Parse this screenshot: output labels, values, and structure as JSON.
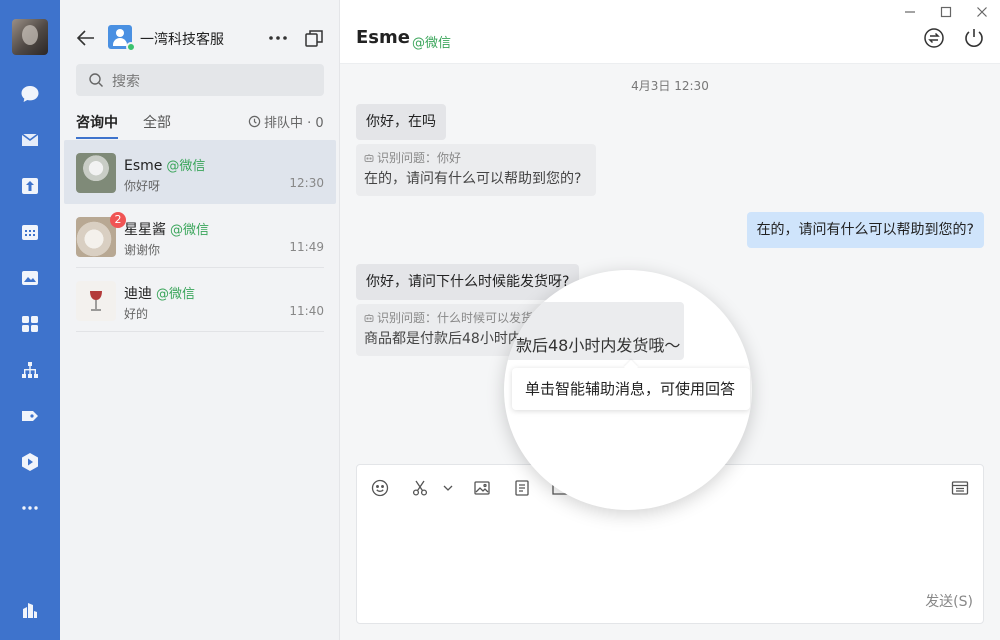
{
  "sidebar": {
    "account_name": "一湾科技客服",
    "search_placeholder": "搜索",
    "tab_active": "咨询中",
    "tab_all": "全部",
    "queue_label": "排队中 · 0",
    "conversations": [
      {
        "name": "Esme",
        "tag": "@微信",
        "preview": "你好呀",
        "time": "12:30"
      },
      {
        "name": "星星酱",
        "tag": "@微信",
        "preview": "谢谢你",
        "time": "11:49",
        "badge": "2"
      },
      {
        "name": "迪迪",
        "tag": "@微信",
        "preview": "好的",
        "time": "11:40"
      }
    ]
  },
  "chat": {
    "title": "Esme",
    "tag": "@微信",
    "timestamp": "4月3日 12:30",
    "msg1": "你好，在吗",
    "assist1_label": "识别问题：你好",
    "assist1_text": "在的，请问有什么可以帮助到您的?",
    "msg_out": "在的，请问有什么可以帮助到您的?",
    "msg2": "你好，请问下什么时候能发货呀?",
    "assist2_label": "识别问题：什么时候可以发货么时候可以发货",
    "assist2_text": "商品都是付款后48小时内",
    "lens_text": "款后48小时内发货哦～",
    "tooltip": "单击智能辅助消息，可使用回答",
    "send_label": "发送(S)"
  },
  "colors": {
    "rail": "#3e73cc",
    "accent_tag": "#3aa55a",
    "out_bubble": "#cfe4fb",
    "badge": "#f05454"
  }
}
